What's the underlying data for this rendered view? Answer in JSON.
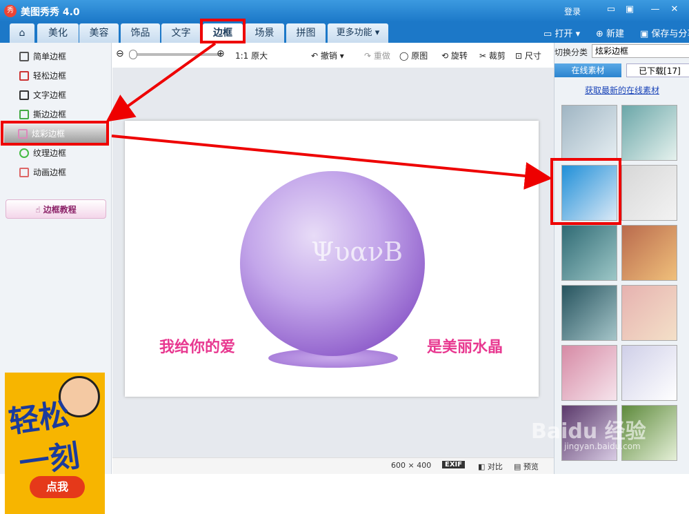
{
  "title": {
    "app": "美图秀秀 4.0",
    "logo": "秀",
    "login": "登录"
  },
  "tabs": [
    {
      "label": "美化"
    },
    {
      "label": "美容"
    },
    {
      "label": "饰品"
    },
    {
      "label": "文字"
    },
    {
      "label": "边框"
    },
    {
      "label": "场景"
    },
    {
      "label": "拼图"
    },
    {
      "label": "更多功能 ▾"
    }
  ],
  "header_actions": {
    "open": "打开",
    "new": "新建",
    "save": "保存与分享"
  },
  "left_menu": [
    {
      "label": "简单边框"
    },
    {
      "label": "轻松边框"
    },
    {
      "label": "文字边框"
    },
    {
      "label": "撕边边框"
    },
    {
      "label": "炫彩边框"
    },
    {
      "label": "纹理边框"
    },
    {
      "label": "动画边框"
    }
  ],
  "tutorial_label": "边框教程",
  "ad": {
    "line1": "轻松",
    "line2": "一刻",
    "button": "点我"
  },
  "toolbar": {
    "zoom_original": "1:1 原大",
    "undo": "撤销",
    "redo": "重做",
    "original": "原图",
    "rotate": "旋转",
    "crop": "裁剪",
    "size": "尺寸"
  },
  "canvas": {
    "watermark": "ΨυανΒ",
    "left_text": "我给你的爱",
    "right_text": "是美丽水晶"
  },
  "status": {
    "dimensions": "600 × 400",
    "exif": "EXIF",
    "compare": "对比",
    "preview": "预览"
  },
  "right_panel": {
    "category_label": "切换分类",
    "category_value": "炫彩边框",
    "tabs": [
      {
        "label": "在线素材"
      },
      {
        "label": "已下载[17]"
      }
    ],
    "fetch_link": "获取最新的在线素材",
    "thumbnails": [
      {
        "colors": [
          "#9fb5c3",
          "#e6eef2"
        ]
      },
      {
        "colors": [
          "#6aa6a8",
          "#e6f2ee"
        ]
      },
      {
        "colors": [
          "#1f8fd8",
          "#dbe9f6"
        ]
      },
      {
        "colors": [
          "#d7d7d7",
          "#f3f3f3"
        ]
      },
      {
        "colors": [
          "#2f6a74",
          "#9dc7c7"
        ]
      },
      {
        "colors": [
          "#b96a4d",
          "#f0c07b"
        ]
      },
      {
        "colors": [
          "#26535e",
          "#a5c5c9"
        ]
      },
      {
        "colors": [
          "#e6b2b0",
          "#f4e0c8"
        ]
      },
      {
        "colors": [
          "#d68aa5",
          "#f6e4ec"
        ]
      },
      {
        "colors": [
          "#cfcfe8",
          "#ffffff"
        ]
      },
      {
        "colors": [
          "#5b3a6b",
          "#d8cbe4"
        ]
      },
      {
        "colors": [
          "#5e8a3c",
          "#e5f0d8"
        ]
      }
    ]
  },
  "watermark_bottom": {
    "brand": "Baidu 经验",
    "url": "jingyan.baidu.com"
  }
}
